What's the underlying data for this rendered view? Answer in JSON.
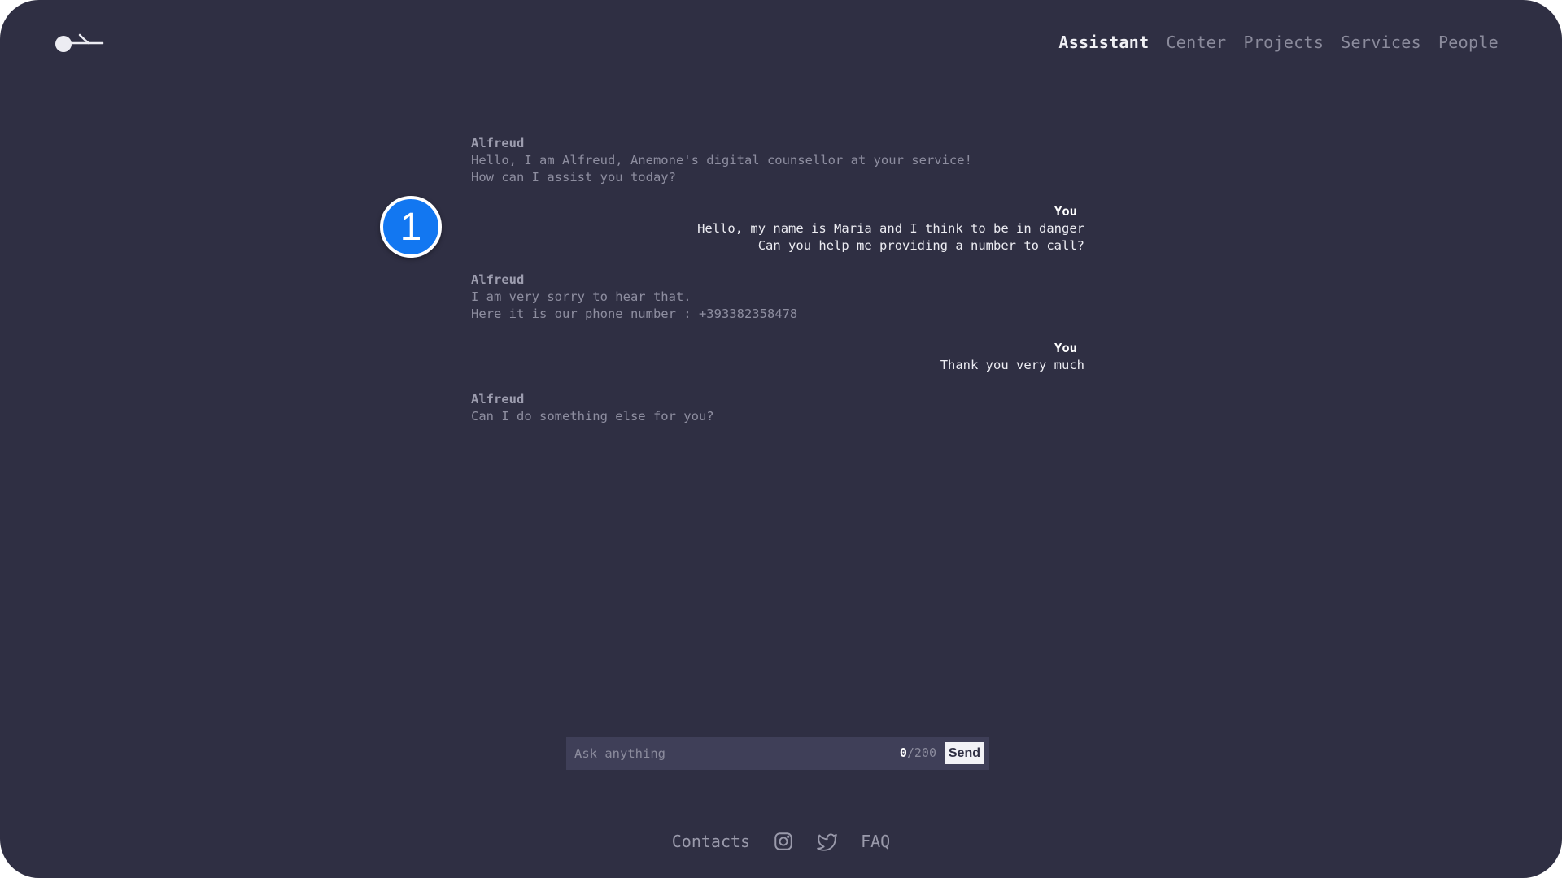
{
  "nav": {
    "items": [
      {
        "label": "Assistant",
        "active": true
      },
      {
        "label": "Center",
        "active": false
      },
      {
        "label": "Projects",
        "active": false
      },
      {
        "label": "Services",
        "active": false
      },
      {
        "label": "People",
        "active": false
      }
    ]
  },
  "step_badge": "1",
  "chat": {
    "messages": [
      {
        "role": "assistant",
        "author": "Alfreud",
        "lines": [
          "Hello, I am Alfreud, Anemone's digital counsellor at your service!",
          "How can I assist you today?"
        ]
      },
      {
        "role": "user",
        "author": "You",
        "lines": [
          "Hello, my name is Maria and I think to be in danger",
          "Can you help me providing a number to call?"
        ]
      },
      {
        "role": "assistant",
        "author": "Alfreud",
        "lines": [
          "I am very sorry to hear that.",
          "Here it is our phone number : +393382358478"
        ]
      },
      {
        "role": "user",
        "author": "You",
        "lines": [
          "Thank you very much"
        ]
      },
      {
        "role": "assistant",
        "author": "Alfreud",
        "lines": [
          "Can I do something else for you?"
        ]
      }
    ]
  },
  "input": {
    "placeholder": "Ask anything",
    "value": "",
    "count": "0",
    "max": "/200",
    "send_label": "Send"
  },
  "footer": {
    "contacts": "Contacts",
    "faq": "FAQ",
    "icons": [
      "instagram-icon",
      "twitter-icon"
    ]
  },
  "colors": {
    "background": "#2f2f43",
    "input_background": "#3f3f58",
    "badge": "#1277f1",
    "muted_text": "#8b8b9c",
    "active_text": "#f0f0f4"
  }
}
